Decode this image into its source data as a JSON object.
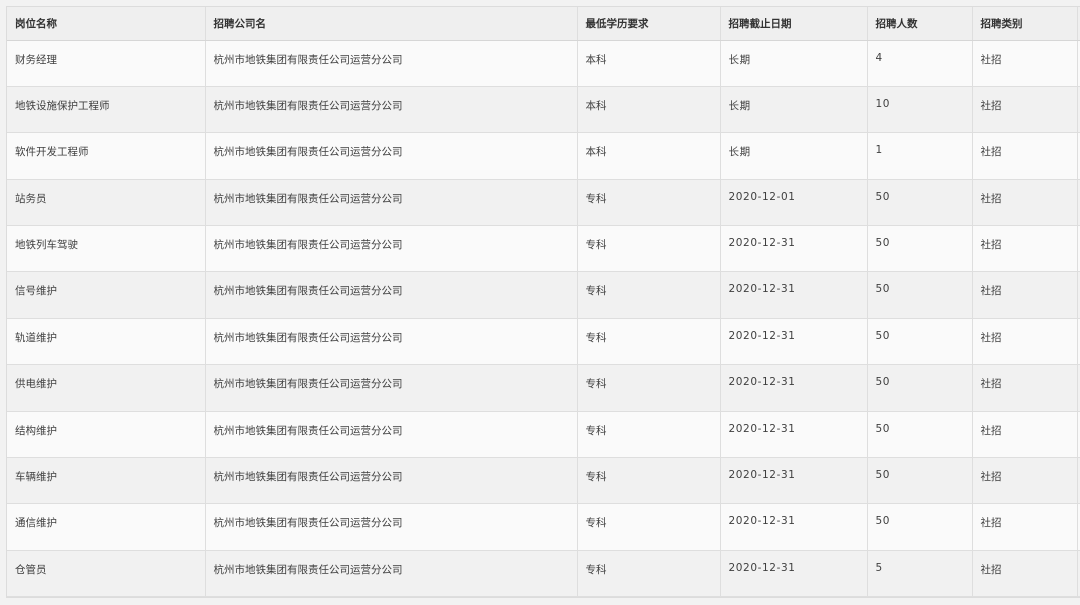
{
  "table": {
    "headers": [
      "岗位名称",
      "招聘公司名",
      "最低学历要求",
      "招聘截止日期",
      "招聘人数",
      "招聘类别"
    ],
    "rows": [
      [
        "财务经理",
        "杭州市地铁集团有限责任公司运营分公司",
        "本科",
        "长期",
        "4",
        "社招"
      ],
      [
        "地铁设施保护工程师",
        "杭州市地铁集团有限责任公司运营分公司",
        "本科",
        "长期",
        "10",
        "社招"
      ],
      [
        "软件开发工程师",
        "杭州市地铁集团有限责任公司运营分公司",
        "本科",
        "长期",
        "1",
        "社招"
      ],
      [
        "站务员",
        "杭州市地铁集团有限责任公司运营分公司",
        "专科",
        "2020-12-01",
        "50",
        "社招"
      ],
      [
        "地铁列车驾驶",
        "杭州市地铁集团有限责任公司运营分公司",
        "专科",
        "2020-12-31",
        "50",
        "社招"
      ],
      [
        "信号维护",
        "杭州市地铁集团有限责任公司运营分公司",
        "专科",
        "2020-12-31",
        "50",
        "社招"
      ],
      [
        "轨道维护",
        "杭州市地铁集团有限责任公司运营分公司",
        "专科",
        "2020-12-31",
        "50",
        "社招"
      ],
      [
        "供电维护",
        "杭州市地铁集团有限责任公司运营分公司",
        "专科",
        "2020-12-31",
        "50",
        "社招"
      ],
      [
        "结构维护",
        "杭州市地铁集团有限责任公司运营分公司",
        "专科",
        "2020-12-31",
        "50",
        "社招"
      ],
      [
        "车辆维护",
        "杭州市地铁集团有限责任公司运营分公司",
        "专科",
        "2020-12-31",
        "50",
        "社招"
      ],
      [
        "通信维护",
        "杭州市地铁集团有限责任公司运营分公司",
        "专科",
        "2020-12-31",
        "50",
        "社招"
      ],
      [
        "仓管员",
        "杭州市地铁集团有限责任公司运营分公司",
        "专科",
        "2020-12-31",
        "5",
        "社招"
      ]
    ]
  }
}
